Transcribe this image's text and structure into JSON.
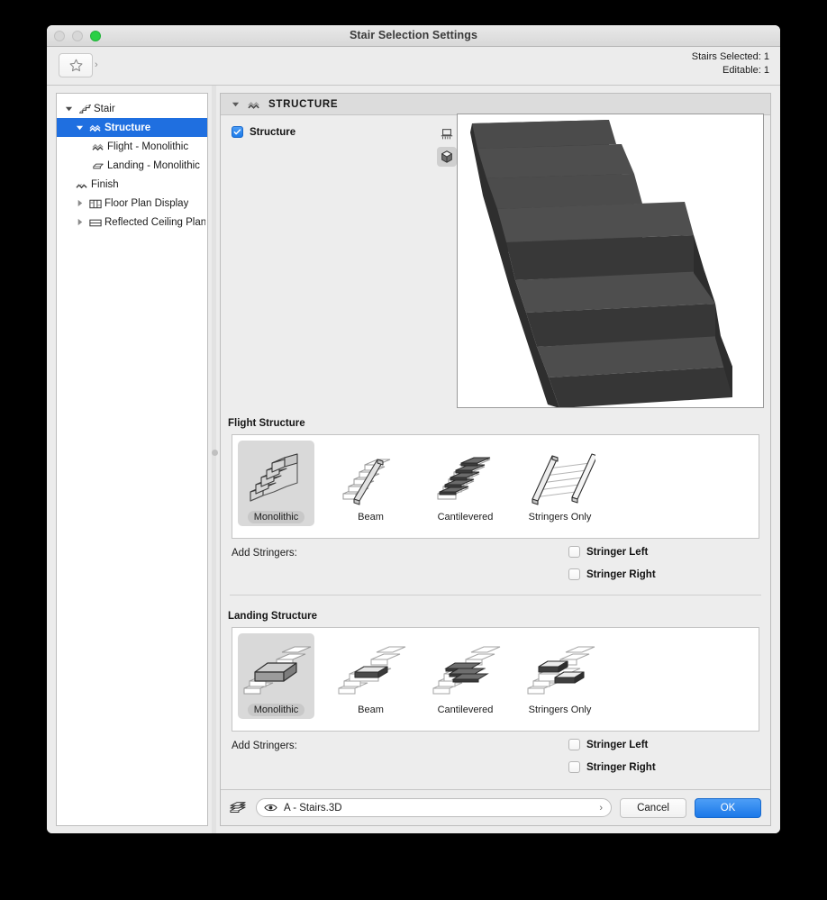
{
  "window": {
    "title": "Stair Selection Settings",
    "traffic_lights": [
      "close",
      "minimize",
      "zoom"
    ]
  },
  "toolbar": {
    "favorites_icon": "star-icon",
    "favorites_arrow": "chevron-right-icon",
    "stairs_selected": "Stairs Selected: 1",
    "editable": "Editable: 1"
  },
  "tree": {
    "items": [
      {
        "label": "Stair",
        "icon": "stair-icon",
        "depth": 0,
        "twisty": "down",
        "selected": false
      },
      {
        "label": "Structure",
        "icon": "structure-icon",
        "depth": 1,
        "twisty": "down",
        "selected": true
      },
      {
        "label": "Flight - Monolithic",
        "icon": "flight-icon",
        "depth": 2,
        "twisty": "none",
        "selected": false
      },
      {
        "label": "Landing - Monolithic",
        "icon": "landing-icon",
        "depth": 2,
        "twisty": "none",
        "selected": false
      },
      {
        "label": "Finish",
        "icon": "finish-icon",
        "depth": 1,
        "twisty": "none",
        "selected": false
      },
      {
        "label": "Floor Plan Display",
        "icon": "floorplan-icon",
        "depth": 1,
        "twisty": "right",
        "selected": false
      },
      {
        "label": "Reflected Ceiling Plan",
        "icon": "ceiling-icon",
        "depth": 1,
        "twisty": "right",
        "selected": false
      }
    ]
  },
  "section": {
    "title": "STRUCTURE",
    "twisty": "down",
    "icon": "structure-icon",
    "checkbox": {
      "label": "Structure",
      "checked": true
    },
    "view_toggles": [
      {
        "name": "elevation-view-icon",
        "active": false
      },
      {
        "name": "3d-view-icon",
        "active": true
      }
    ],
    "preview_alt": "monolithic-stair-3d-preview"
  },
  "flight": {
    "group_label": "Flight Structure",
    "options": [
      {
        "label": "Monolithic",
        "selected": true
      },
      {
        "label": "Beam",
        "selected": false
      },
      {
        "label": "Cantilevered",
        "selected": false
      },
      {
        "label": "Stringers Only",
        "selected": false
      }
    ],
    "add_stringers_label": "Add Stringers:",
    "stringers": [
      {
        "label": "Stringer Left",
        "checked": false
      },
      {
        "label": "Stringer Right",
        "checked": false
      }
    ]
  },
  "landing": {
    "group_label": "Landing Structure",
    "options": [
      {
        "label": "Monolithic",
        "selected": true
      },
      {
        "label": "Beam",
        "selected": false
      },
      {
        "label": "Cantilevered",
        "selected": false
      },
      {
        "label": "Stringers Only",
        "selected": false
      }
    ],
    "add_stringers_label": "Add Stringers:",
    "stringers": [
      {
        "label": "Stringer Left",
        "checked": false
      },
      {
        "label": "Stringer Right",
        "checked": false
      }
    ]
  },
  "bottom": {
    "layers_icon": "layers-icon",
    "eye_icon": "eye-icon",
    "layer_value": "A - Stairs.3D",
    "layer_chevron": "chevron-right-icon",
    "cancel_label": "Cancel",
    "ok_label": "OK"
  },
  "colors": {
    "accent": "#1d7ae8",
    "selection": "#1f6fe0",
    "window_bg": "#ececec",
    "panel_bg": "#ededed",
    "section_header": "#dcdcdc",
    "green_light": "#2ad045"
  }
}
